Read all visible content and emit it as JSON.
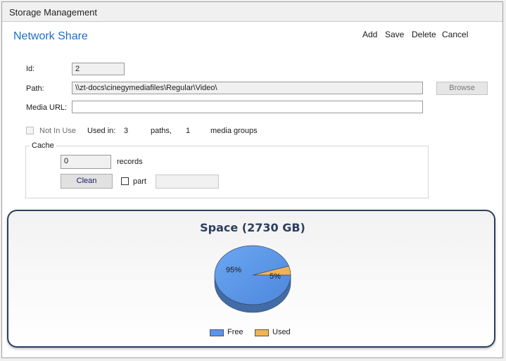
{
  "window": {
    "title": "Storage Management"
  },
  "section": {
    "title": "Network Share"
  },
  "actions": {
    "add": "Add",
    "save": "Save",
    "delete": "Delete",
    "cancel": "Cancel"
  },
  "form": {
    "id_label": "Id:",
    "id_value": "2",
    "path_label": "Path:",
    "path_value": "\\\\zt-docs\\cinegymediafiles\\Regular\\Video\\",
    "browse_label": "Browse",
    "media_url_label": "Media URL:",
    "media_url_value": "",
    "not_in_use_label": "Not In Use",
    "used_in_label": "Used in:",
    "paths_count": "3",
    "paths_label": "paths,",
    "groups_count": "1",
    "groups_label": "media groups"
  },
  "cache": {
    "title": "Cache",
    "records_value": "0",
    "records_label": "records",
    "clean_label": "Clean",
    "part_label": "part",
    "part_value": ""
  },
  "chart_data": {
    "type": "pie",
    "title": "Space (2730 GB)",
    "labels": [
      "Free",
      "Used"
    ],
    "values": [
      95,
      5
    ],
    "data_labels": [
      "95%",
      "5%"
    ],
    "colors": [
      "#5a96e6",
      "#f2b25a"
    ],
    "legend_position": "bottom"
  }
}
